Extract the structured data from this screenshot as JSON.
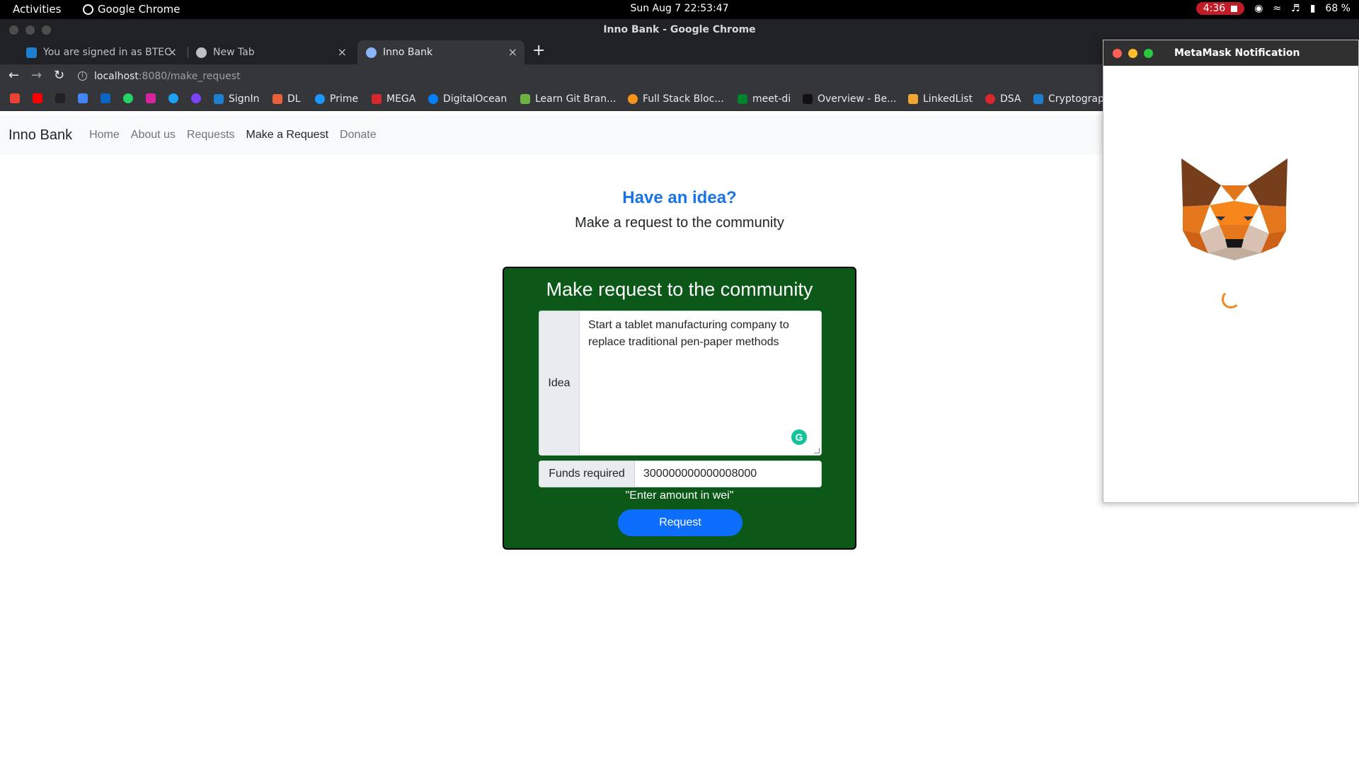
{
  "os_bar": {
    "activities": "Activities",
    "app_name": "Google Chrome",
    "clock": "Sun Aug 7  22:53:47",
    "record_time": "4:36",
    "battery": "68 %"
  },
  "window": {
    "title": "Inno Bank - Google Chrome"
  },
  "tabs": [
    {
      "label": "You are signed in as BTEC"
    },
    {
      "label": "New Tab"
    },
    {
      "label": "Inno Bank"
    }
  ],
  "address": {
    "host": "localhost",
    "path": ":8080/make_request"
  },
  "bookmarks": [
    {
      "label": "SignIn"
    },
    {
      "label": "DL"
    },
    {
      "label": "Prime"
    },
    {
      "label": "MEGA"
    },
    {
      "label": "DigitalOcean"
    },
    {
      "label": "Learn Git Bran..."
    },
    {
      "label": "Full Stack Bloc..."
    },
    {
      "label": "meet-di"
    },
    {
      "label": "Overview - Be..."
    },
    {
      "label": "LinkedList"
    },
    {
      "label": "DSA"
    },
    {
      "label": "Cryptograp"
    }
  ],
  "navbar": {
    "brand": "Inno Bank",
    "links": [
      "Home",
      "About us",
      "Requests",
      "Make a Request",
      "Donate"
    ]
  },
  "hero": {
    "title": "Have an idea?",
    "subtitle": "Make a request to the community"
  },
  "form": {
    "title": "Make request to the community",
    "idea_label": "Idea",
    "idea_value": "Start a tablet manufacturing company to replace traditional pen-paper methods",
    "funds_label": "Funds required",
    "funds_value": "300000000000008000",
    "hint": "\"Enter amount in wei\"",
    "submit_label": "Request"
  },
  "metamask": {
    "title": "MetaMask Notification"
  },
  "colors": {
    "card_bg": "#0b5818",
    "accent_blue": "#1a73e8",
    "button_blue": "#0d6efd",
    "metamask_orange": "#f6851b"
  }
}
